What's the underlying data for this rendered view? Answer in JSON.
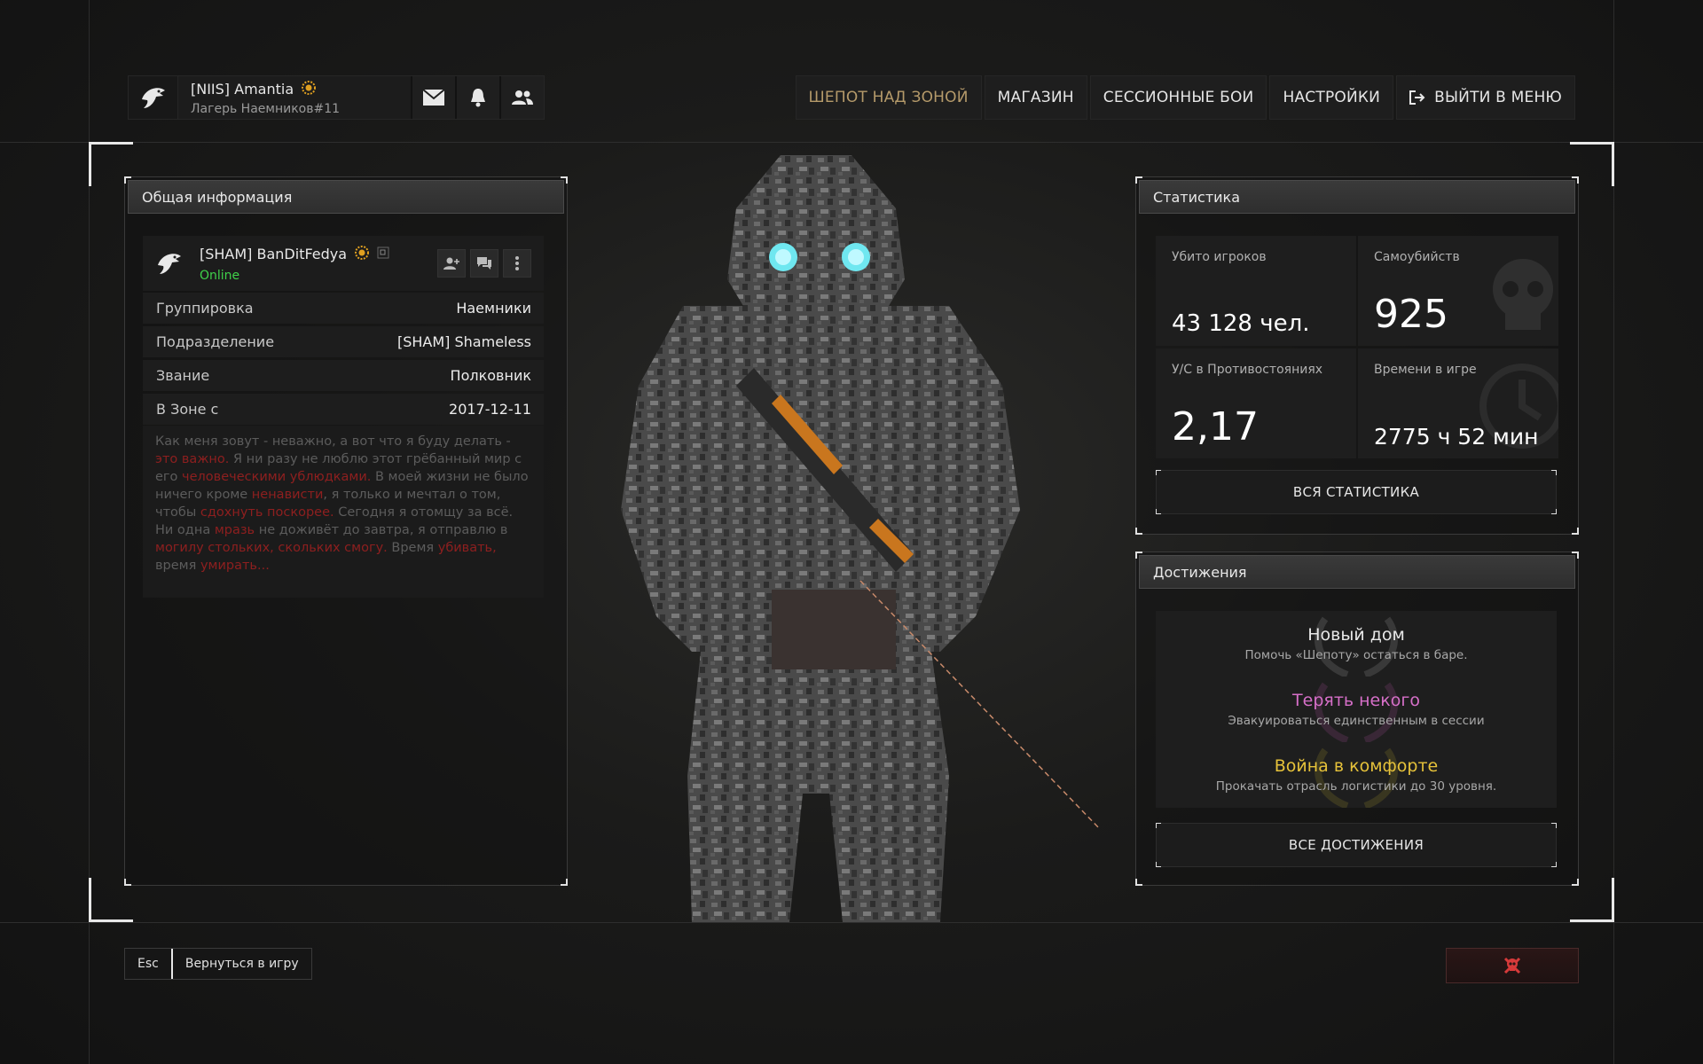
{
  "profile": {
    "name": "[NIIS] Amantia",
    "subtitle": "Лагерь Наемников#11",
    "icons": [
      "eagle-logo-icon",
      "badge-icon",
      "mail-icon",
      "bell-icon",
      "friends-icon"
    ]
  },
  "nav": {
    "items": [
      {
        "label": "ШЕПОТ НАД ЗОНОЙ",
        "active": true
      },
      {
        "label": "МАГАЗИН",
        "active": false
      },
      {
        "label": "СЕССИОННЫЕ БОИ",
        "active": false
      },
      {
        "label": "НАСТРОЙКИ",
        "active": false
      },
      {
        "label": "ВЫЙТИ В МЕНЮ",
        "active": false,
        "icon": "exit-icon"
      }
    ]
  },
  "general": {
    "header": "Общая информация",
    "player": {
      "name": "[SHAM] BanDitFedya",
      "status": "Online"
    },
    "rows": [
      {
        "label": "Группировка",
        "value": "Наемники"
      },
      {
        "label": "Подразделение",
        "value": "[SHAM] Shameless"
      },
      {
        "label": "Звание",
        "value": "Полковник"
      },
      {
        "label": "В Зоне с",
        "value": "2017-12-11"
      }
    ],
    "bio": [
      {
        "t": "Как меня зовут - неважно, а вот что я буду делать - ",
        "hl": false
      },
      {
        "t": "это важно.",
        "hl": true
      },
      {
        "t": " Я ни разу не люблю этот грёбанный мир с его ",
        "hl": false
      },
      {
        "t": "человеческими ублюдками.",
        "hl": true
      },
      {
        "t": " В моей жизни не было ничего кроме ",
        "hl": false
      },
      {
        "t": "ненависти",
        "hl": true
      },
      {
        "t": ", я только и мечтал о том, чтобы ",
        "hl": false
      },
      {
        "t": "сдохнуть поскорее.",
        "hl": true
      },
      {
        "t": " Сегодня я отомщу за всё. Ни одна ",
        "hl": false
      },
      {
        "t": "мразь",
        "hl": true
      },
      {
        "t": " не доживёт до завтра, я отправлю в ",
        "hl": false
      },
      {
        "t": "могилу стольких, скольких смогу.",
        "hl": true
      },
      {
        "t": " Время ",
        "hl": false
      },
      {
        "t": "убивать,",
        "hl": true
      },
      {
        "t": " время ",
        "hl": false
      },
      {
        "t": "умирать...",
        "hl": true
      }
    ]
  },
  "stats": {
    "header": "Статистика",
    "cells": [
      {
        "label": "Убито игроков",
        "value": "43 128 чел."
      },
      {
        "label": "Самоубийств",
        "value": "925"
      },
      {
        "label": "У/С в Противостояниях",
        "value": "2,17"
      },
      {
        "label": "Времени в игре",
        "value": "2775 ч 52 мин"
      }
    ],
    "all_button": "ВСЯ СТАТИСТИКА"
  },
  "achievements": {
    "header": "Достижения",
    "items": [
      {
        "title": "Новый дом",
        "desc": "Помочь «Шепоту» остаться в баре.",
        "color": "#e8e8e8",
        "laurel": "#9a9a9a"
      },
      {
        "title": "Терять некого",
        "desc": "Эвакуироваться единственным в сессии",
        "color": "#d66fc8",
        "laurel": "#9a4a8a"
      },
      {
        "title": "Война в комфорте",
        "desc": "Прокачать отрасль логистики до 30 уровня.",
        "color": "#e6c23a",
        "laurel": "#9a8a2a"
      }
    ],
    "all_button": "ВСЕ ДОСТИЖЕНИЯ"
  },
  "bottom": {
    "esc_key": "Esc",
    "esc_label": "Вернуться в игру",
    "death_icon": "skull-crossbones-icon",
    "accent": "#d63a3a"
  }
}
